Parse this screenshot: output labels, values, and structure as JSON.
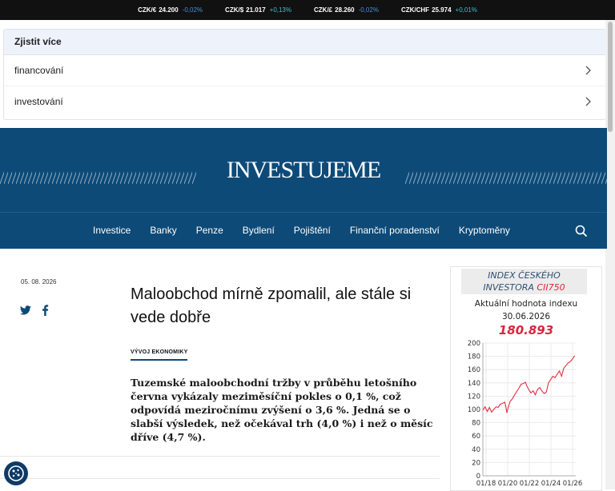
{
  "ticker": [
    {
      "pair": "CZK/€",
      "value": "24.200",
      "change": "-0,02%",
      "color": "#4a90d9"
    },
    {
      "pair": "CZK/$",
      "value": "21.017",
      "change": "+0,13%",
      "color": "#3ec1c9"
    },
    {
      "pair": "CZK/£",
      "value": "28.260",
      "change": "-0,02%",
      "color": "#4a90d9"
    },
    {
      "pair": "CZK/CHF",
      "value": "25.974",
      "change": "+0,01%",
      "color": "#3ec1c9"
    }
  ],
  "learn_more": {
    "title": "Zjistit více",
    "items": [
      "financování",
      "investování"
    ]
  },
  "banner": {
    "brand": "INVESTUJEME"
  },
  "nav": {
    "items": [
      "Investice",
      "Banky",
      "Penze",
      "Bydlení",
      "Pojištění",
      "Finanční poradenství",
      "Kryptoměny"
    ]
  },
  "article": {
    "date": "05. 08. 2026",
    "headline": "Maloobchod mírně zpomalil, ale stále si vede dobře",
    "tag": "VÝVOJ EKONOMIKY",
    "perex": "Tuzemské maloobchodní tržby v průběhu letošního června vykázaly meziměsíční pokles o 0,1 %, což odpovídá meziročnímu zvýšení o 3,6 %. Jedná se o slabší výsledek, než očekával trh (4,0 %) i než o měsíc dříve (4,7 %)."
  },
  "widget": {
    "title_line1": "INDEX ČESKÉHO",
    "title_line2": "INVESTORA",
    "title_code": "CII750",
    "subtitle": "Aktuální hodnota indexu",
    "date": "30.06.2026",
    "value": "180.893"
  },
  "chart_data": {
    "type": "line",
    "title": "",
    "xlabel": "",
    "ylabel": "",
    "ylim": [
      0,
      200
    ],
    "yticks": [
      0,
      20,
      40,
      60,
      80,
      100,
      120,
      140,
      160,
      180,
      200
    ],
    "xticks": [
      "01/18",
      "01/20",
      "01/22",
      "01/24",
      "01/26"
    ],
    "xlim": [
      2018.0,
      2026.5
    ],
    "grid": true,
    "color": "#e03040",
    "series": [
      {
        "points": [
          [
            2018.0,
            99
          ],
          [
            2018.2,
            104
          ],
          [
            2018.4,
            97
          ],
          [
            2018.6,
            103
          ],
          [
            2018.8,
            96
          ],
          [
            2019.0,
            100
          ],
          [
            2019.2,
            104
          ],
          [
            2019.4,
            103
          ],
          [
            2019.6,
            108
          ],
          [
            2019.8,
            109
          ],
          [
            2020.0,
            111
          ],
          [
            2020.1,
            104
          ],
          [
            2020.2,
            95
          ],
          [
            2020.35,
            105
          ],
          [
            2020.5,
            112
          ],
          [
            2020.7,
            116
          ],
          [
            2020.9,
            122
          ],
          [
            2021.1,
            127
          ],
          [
            2021.3,
            132
          ],
          [
            2021.5,
            138
          ],
          [
            2021.7,
            139
          ],
          [
            2021.9,
            141
          ],
          [
            2022.0,
            136
          ],
          [
            2022.2,
            130
          ],
          [
            2022.4,
            125
          ],
          [
            2022.6,
            128
          ],
          [
            2022.8,
            122
          ],
          [
            2023.0,
            130
          ],
          [
            2023.2,
            133
          ],
          [
            2023.4,
            128
          ],
          [
            2023.6,
            124
          ],
          [
            2023.8,
            126
          ],
          [
            2024.0,
            140
          ],
          [
            2024.2,
            145
          ],
          [
            2024.4,
            150
          ],
          [
            2024.6,
            148
          ],
          [
            2024.8,
            153
          ],
          [
            2025.0,
            158
          ],
          [
            2025.2,
            150
          ],
          [
            2025.4,
            162
          ],
          [
            2025.6,
            166
          ],
          [
            2025.8,
            170
          ],
          [
            2026.0,
            172
          ],
          [
            2026.2,
            176
          ],
          [
            2026.4,
            181
          ]
        ]
      }
    ]
  }
}
